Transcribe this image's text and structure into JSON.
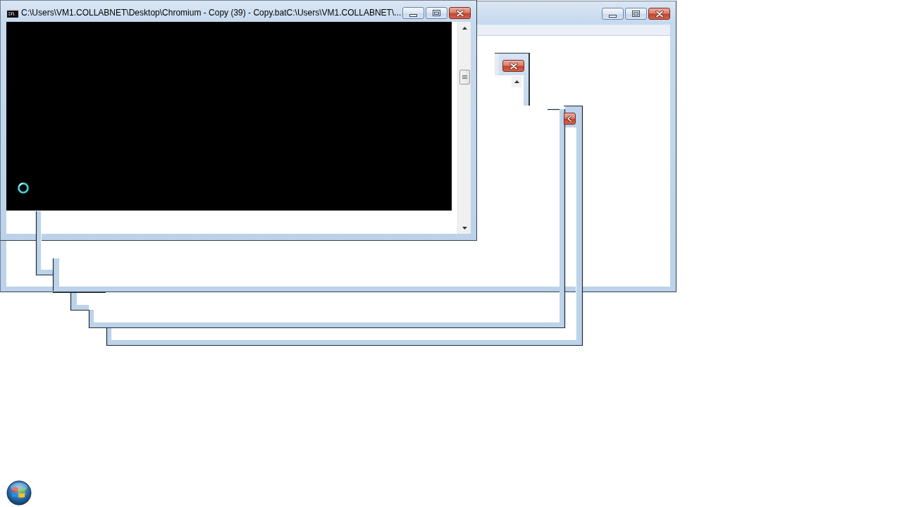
{
  "console_window": {
    "title": "C:\\Users\\VM1.COLLABNET\\Desktop\\Chromium - Copy (39) - Copy.batC:\\Users\\VM1.COLLABNET\\..."
  }
}
